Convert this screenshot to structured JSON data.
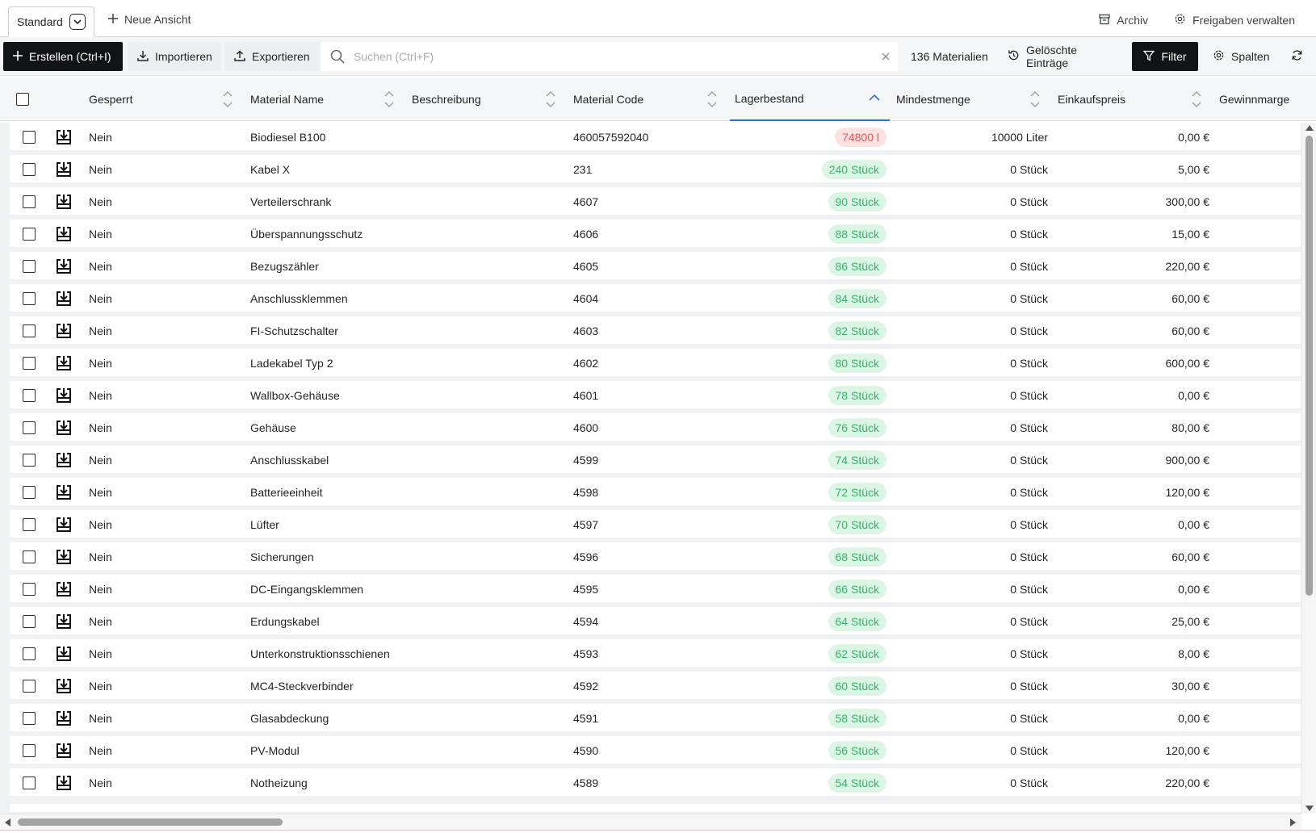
{
  "viewbar": {
    "tab_label": "Standard",
    "new_view_label": "Neue Ansicht",
    "archive_label": "Archiv",
    "shares_label": "Freigaben verwalten"
  },
  "toolbar": {
    "create_label": "Erstellen (Ctrl+I)",
    "import_label": "Importieren",
    "export_label": "Exportieren",
    "search_placeholder": "Suchen (Ctrl+F)",
    "count_label": "136 Materialien",
    "deleted_label": "Gelöschte Einträge",
    "filter_label": "Filter",
    "columns_label": "Spalten"
  },
  "columns": {
    "locked": "Gesperrt",
    "name": "Material Name",
    "description": "Beschreibung",
    "code": "Material Code",
    "stock": "Lagerbestand",
    "min_qty": "Mindestmenge",
    "purchase_price": "Einkaufspreis",
    "margin": "Gewinnmarge"
  },
  "rows": [
    {
      "locked": "Nein",
      "name": "Biodiesel B100",
      "description": "",
      "code": "460057592040",
      "stock": "74800 l",
      "stock_status": "low",
      "min_qty": "10000 Liter",
      "price": "0,00 €"
    },
    {
      "locked": "Nein",
      "name": "Kabel X",
      "description": "",
      "code": "231",
      "stock": "240 Stück",
      "stock_status": "ok",
      "min_qty": "0 Stück",
      "price": "5,00 €"
    },
    {
      "locked": "Nein",
      "name": "Verteilerschrank",
      "description": "",
      "code": "4607",
      "stock": "90 Stück",
      "stock_status": "ok",
      "min_qty": "0 Stück",
      "price": "300,00 €"
    },
    {
      "locked": "Nein",
      "name": "Überspannungsschutz",
      "description": "",
      "code": "4606",
      "stock": "88 Stück",
      "stock_status": "ok",
      "min_qty": "0 Stück",
      "price": "15,00 €"
    },
    {
      "locked": "Nein",
      "name": "Bezugszähler",
      "description": "",
      "code": "4605",
      "stock": "86 Stück",
      "stock_status": "ok",
      "min_qty": "0 Stück",
      "price": "220,00 €"
    },
    {
      "locked": "Nein",
      "name": "Anschlussklemmen",
      "description": "",
      "code": "4604",
      "stock": "84 Stück",
      "stock_status": "ok",
      "min_qty": "0 Stück",
      "price": "60,00 €"
    },
    {
      "locked": "Nein",
      "name": "FI-Schutzschalter",
      "description": "",
      "code": "4603",
      "stock": "82 Stück",
      "stock_status": "ok",
      "min_qty": "0 Stück",
      "price": "60,00 €"
    },
    {
      "locked": "Nein",
      "name": "Ladekabel Typ 2",
      "description": "",
      "code": "4602",
      "stock": "80 Stück",
      "stock_status": "ok",
      "min_qty": "0 Stück",
      "price": "600,00 €"
    },
    {
      "locked": "Nein",
      "name": "Wallbox-Gehäuse",
      "description": "",
      "code": "4601",
      "stock": "78 Stück",
      "stock_status": "ok",
      "min_qty": "0 Stück",
      "price": "0,00 €"
    },
    {
      "locked": "Nein",
      "name": "Gehäuse",
      "description": "",
      "code": "4600",
      "stock": "76 Stück",
      "stock_status": "ok",
      "min_qty": "0 Stück",
      "price": "80,00 €"
    },
    {
      "locked": "Nein",
      "name": "Anschlusskabel",
      "description": "",
      "code": "4599",
      "stock": "74 Stück",
      "stock_status": "ok",
      "min_qty": "0 Stück",
      "price": "900,00 €"
    },
    {
      "locked": "Nein",
      "name": "Batterieeinheit",
      "description": "",
      "code": "4598",
      "stock": "72 Stück",
      "stock_status": "ok",
      "min_qty": "0 Stück",
      "price": "120,00 €"
    },
    {
      "locked": "Nein",
      "name": "Lüfter",
      "description": "",
      "code": "4597",
      "stock": "70 Stück",
      "stock_status": "ok",
      "min_qty": "0 Stück",
      "price": "0,00 €"
    },
    {
      "locked": "Nein",
      "name": "Sicherungen",
      "description": "",
      "code": "4596",
      "stock": "68 Stück",
      "stock_status": "ok",
      "min_qty": "0 Stück",
      "price": "60,00 €"
    },
    {
      "locked": "Nein",
      "name": "DC-Eingangsklemmen",
      "description": "",
      "code": "4595",
      "stock": "66 Stück",
      "stock_status": "ok",
      "min_qty": "0 Stück",
      "price": "0,00 €"
    },
    {
      "locked": "Nein",
      "name": "Erdungskabel",
      "description": "",
      "code": "4594",
      "stock": "64 Stück",
      "stock_status": "ok",
      "min_qty": "0 Stück",
      "price": "25,00 €"
    },
    {
      "locked": "Nein",
      "name": "Unterkonstruktionsschienen",
      "description": "",
      "code": "4593",
      "stock": "62 Stück",
      "stock_status": "ok",
      "min_qty": "0 Stück",
      "price": "8,00 €"
    },
    {
      "locked": "Nein",
      "name": "MC4-Steckverbinder",
      "description": "",
      "code": "4592",
      "stock": "60 Stück",
      "stock_status": "ok",
      "min_qty": "0 Stück",
      "price": "30,00 €"
    },
    {
      "locked": "Nein",
      "name": "Glasabdeckung",
      "description": "",
      "code": "4591",
      "stock": "58 Stück",
      "stock_status": "ok",
      "min_qty": "0 Stück",
      "price": "0,00 €"
    },
    {
      "locked": "Nein",
      "name": "PV-Modul",
      "description": "",
      "code": "4590",
      "stock": "56 Stück",
      "stock_status": "ok",
      "min_qty": "0 Stück",
      "price": "120,00 €"
    },
    {
      "locked": "Nein",
      "name": "Notheizung",
      "description": "",
      "code": "4589",
      "stock": "54 Stück",
      "stock_status": "ok",
      "min_qty": "0 Stück",
      "price": "220,00 €"
    }
  ],
  "colors": {
    "accent": "#2f6fdb",
    "stock_ok_bg": "#dcf5e5",
    "stock_ok_text": "#35b46a",
    "stock_low_bg": "#fde2e2",
    "stock_low_text": "#e0565a"
  }
}
